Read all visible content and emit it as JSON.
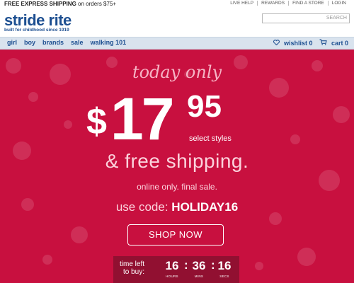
{
  "topbar": {
    "shipping_bold": "FREE EXPRESS SHIPPING",
    "shipping_rest": " on orders $75+",
    "links": [
      "LIVE HELP",
      "REWARDS",
      "FIND A STORE",
      "LOGIN"
    ]
  },
  "header": {
    "logo_name": "stride rite",
    "logo_tagline": "built for childhood since 1919",
    "search_placeholder": "",
    "search_button": "SEARCH"
  },
  "nav": {
    "items": [
      "girl",
      "boy",
      "brands",
      "sale",
      "walking 101"
    ],
    "wishlist": "wishlist 0",
    "cart": "cart 0"
  },
  "hero": {
    "today": "today only",
    "dollar": "$",
    "price_main": "17",
    "price_cents": "95",
    "select_styles": "select styles",
    "free_shipping": "& free shipping.",
    "online_only": "online only. final sale.",
    "code_prefix": "use code: ",
    "code": "HOLIDAY16",
    "shop_now": "SHOP NOW"
  },
  "timer": {
    "label_line1": "time left",
    "label_line2": "to buy:",
    "hours": "16",
    "mins": "36",
    "secs": "16",
    "hours_label": "HOURS",
    "mins_label": "MINS",
    "secs_label": "SECS"
  },
  "colors": {
    "brand_blue": "#1d4f91",
    "hero_red": "#c8103f",
    "timer_bg": "#911031",
    "nav_bg": "#d9e3ee"
  }
}
